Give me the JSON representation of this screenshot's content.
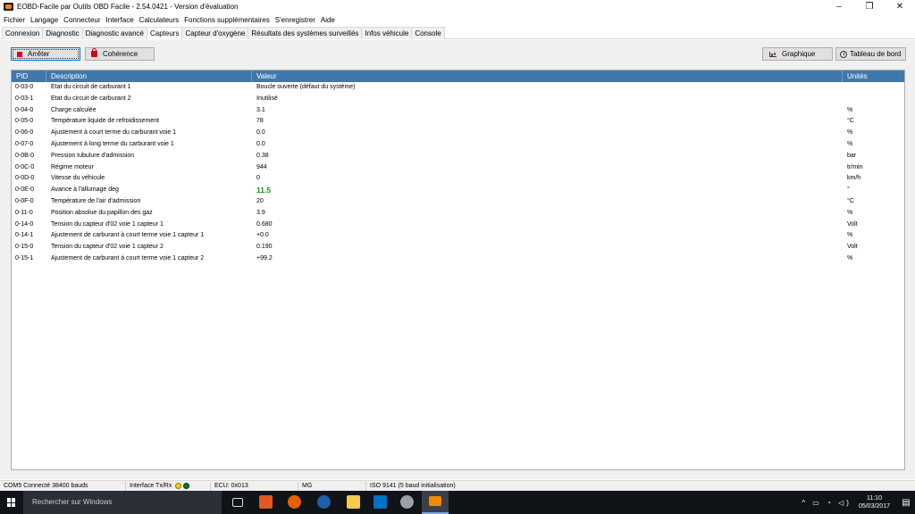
{
  "window": {
    "title": "EOBD-Facile par Outils OBD Facile - 2.54.0421 - Version d'évaluation",
    "minimize": "–",
    "maximize": "❐",
    "close": "✕"
  },
  "menu": [
    "Fichier",
    "Langage",
    "Connecteur",
    "Interface",
    "Calculateurs",
    "Fonctions supplémentaires",
    "S'enregistrer",
    "Aide"
  ],
  "tabs": [
    {
      "label": "Connexion"
    },
    {
      "label": "Diagnostic"
    },
    {
      "label": "Diagnostic avancé"
    },
    {
      "label": "Capteurs",
      "active": true
    },
    {
      "label": "Capteur d'oxygène"
    },
    {
      "label": "Résultats des systèmes surveillés"
    },
    {
      "label": "Infos véhicule"
    },
    {
      "label": "Console"
    }
  ],
  "toolbar": {
    "stop_label": "Arrêter",
    "coherence_label": "Cohérence",
    "graph_label": "Graphique",
    "dashboard_label": "Tableau de bord"
  },
  "table": {
    "headers": {
      "pid": "PID",
      "description": "Description",
      "value": "Valeur",
      "unit": "Unités"
    },
    "rows": [
      {
        "pid": "0-03-0",
        "description": "Etat du circuit de carburant 1",
        "value": "Boucle ouverte (défaut du système)",
        "unit": ""
      },
      {
        "pid": "0-03-1",
        "description": "Etat du circuit de carburant 2",
        "value": "Inutilisé",
        "unit": ""
      },
      {
        "pid": "0-04-0",
        "description": "Charge calculée",
        "value": "3.1",
        "unit": "%"
      },
      {
        "pid": "0-05-0",
        "description": "Température liquide de refroidissement",
        "value": "78",
        "unit": "°C"
      },
      {
        "pid": "0-06-0",
        "description": "Ajustement à court terme du carburant voie 1",
        "value": "0.0",
        "unit": "%"
      },
      {
        "pid": "0-07-0",
        "description": "Ajustement à long terme du carburant voie 1",
        "value": "0.0",
        "unit": "%"
      },
      {
        "pid": "0-0B-0",
        "description": "Pression tubulure d'admission",
        "value": "0.38",
        "unit": "bar"
      },
      {
        "pid": "0-0C-0",
        "description": "Régime moteur",
        "value": "944",
        "unit": "tr/min"
      },
      {
        "pid": "0-0D-0",
        "description": "Vitesse du véhicule",
        "value": "0",
        "unit": "km/h"
      },
      {
        "pid": "0-0E-0",
        "description": "Avance à l'allumage deg",
        "value": "11.5",
        "unit": "°",
        "highlight": true
      },
      {
        "pid": "0-0F-0",
        "description": "Température de l'air d'admission",
        "value": "20",
        "unit": "°C"
      },
      {
        "pid": "0-11-0",
        "description": "Position absolue du papillon des gaz",
        "value": "3.9",
        "unit": "%"
      },
      {
        "pid": "0-14-0",
        "description": "Tension du capteur d'02 voie 1 capteur 1",
        "value": "0.680",
        "unit": "Volt"
      },
      {
        "pid": "0-14-1",
        "description": "Ajustement de carburant à court terme voie 1 capteur 1",
        "value": "+0.0",
        "unit": "%"
      },
      {
        "pid": "0-15-0",
        "description": "Tension du capteur d'02 voie 1 capteur 2",
        "value": "0.190",
        "unit": "Volt"
      },
      {
        "pid": "0-15-1",
        "description": "Ajustement de carburant à court terme voie 1 capteur 2",
        "value": "+99.2",
        "unit": "%"
      }
    ]
  },
  "status": {
    "port": "COM5 Connecté 38400 bauds",
    "interface": "Interface Tx/Rx",
    "ecu": "ECU: 0x013",
    "mg": "MG",
    "protocol": "ISO 9141 (5 baud initialisation)"
  },
  "taskbar": {
    "search_placeholder": "Rechercher sur Windows",
    "time": "11:10",
    "date": "05/03/2017"
  }
}
